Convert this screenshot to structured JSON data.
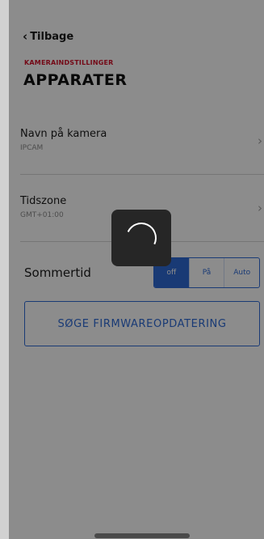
{
  "nav": {
    "back_label": "Tilbage"
  },
  "header": {
    "section": "KAMERAINDSTILLINGER",
    "title": "APPARATER"
  },
  "rows": [
    {
      "title": "Navn på kamera",
      "value": "IPCAM"
    },
    {
      "title": "Tidszone",
      "value": "GMT+01:00"
    }
  ],
  "dst": {
    "label": "Sommertid",
    "options": [
      "off",
      "På",
      "Auto"
    ],
    "selected": "off"
  },
  "firmware_button": {
    "label": "SØGE FIRMWAREOPDATERING"
  },
  "loading": {
    "visible": true
  },
  "colors": {
    "accent": "#2f6bd6",
    "section_red": "#d3122a"
  }
}
